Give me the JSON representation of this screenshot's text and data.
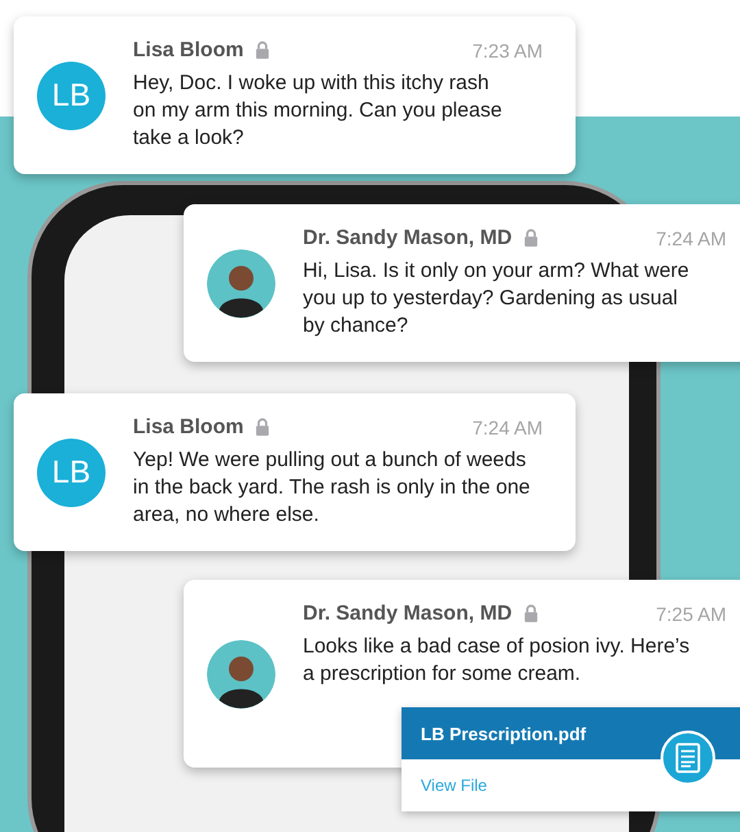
{
  "messages": [
    {
      "sender": "Lisa Bloom",
      "avatar": {
        "kind": "initials",
        "initials": "LB"
      },
      "locked": true,
      "time": "7:23 AM",
      "text": "Hey, Doc. I woke up with this itchy rash\non my arm this morning. Can you please\ntake a look?"
    },
    {
      "sender": "Dr. Sandy Mason, MD",
      "avatar": {
        "kind": "photo"
      },
      "locked": true,
      "time": "7:24 AM",
      "text": "Hi, Lisa. Is it only on your arm? What were\nyou up to yesterday? Gardening as usual\nby chance?"
    },
    {
      "sender": "Lisa Bloom",
      "avatar": {
        "kind": "initials",
        "initials": "LB"
      },
      "locked": true,
      "time": "7:24 AM",
      "text": "Yep! We were pulling out a bunch of weeds\nin the back yard. The rash is only in the one\narea, no where else."
    },
    {
      "sender": "Dr. Sandy Mason, MD",
      "avatar": {
        "kind": "photo"
      },
      "locked": true,
      "time": "7:25 AM",
      "text": "Looks like a bad case of posion ivy. Here’s\na prescription for some cream.",
      "attachment": {
        "file_name": "LB Prescription.pdf",
        "action": "View File"
      }
    }
  ]
}
